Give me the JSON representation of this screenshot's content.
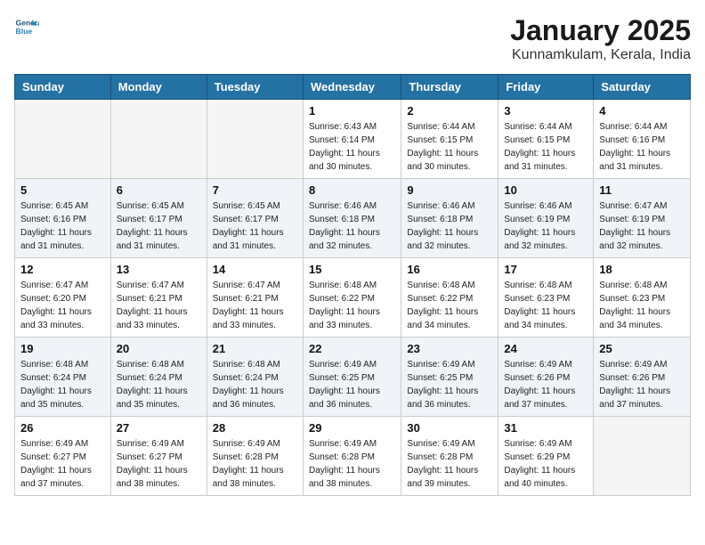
{
  "header": {
    "logo_line1": "General",
    "logo_line2": "Blue",
    "month": "January 2025",
    "location": "Kunnamkulam, Kerala, India"
  },
  "weekdays": [
    "Sunday",
    "Monday",
    "Tuesday",
    "Wednesday",
    "Thursday",
    "Friday",
    "Saturday"
  ],
  "weeks": [
    [
      {
        "day": "",
        "info": ""
      },
      {
        "day": "",
        "info": ""
      },
      {
        "day": "",
        "info": ""
      },
      {
        "day": "1",
        "info": "Sunrise: 6:43 AM\nSunset: 6:14 PM\nDaylight: 11 hours\nand 30 minutes."
      },
      {
        "day": "2",
        "info": "Sunrise: 6:44 AM\nSunset: 6:15 PM\nDaylight: 11 hours\nand 30 minutes."
      },
      {
        "day": "3",
        "info": "Sunrise: 6:44 AM\nSunset: 6:15 PM\nDaylight: 11 hours\nand 31 minutes."
      },
      {
        "day": "4",
        "info": "Sunrise: 6:44 AM\nSunset: 6:16 PM\nDaylight: 11 hours\nand 31 minutes."
      }
    ],
    [
      {
        "day": "5",
        "info": "Sunrise: 6:45 AM\nSunset: 6:16 PM\nDaylight: 11 hours\nand 31 minutes."
      },
      {
        "day": "6",
        "info": "Sunrise: 6:45 AM\nSunset: 6:17 PM\nDaylight: 11 hours\nand 31 minutes."
      },
      {
        "day": "7",
        "info": "Sunrise: 6:45 AM\nSunset: 6:17 PM\nDaylight: 11 hours\nand 31 minutes."
      },
      {
        "day": "8",
        "info": "Sunrise: 6:46 AM\nSunset: 6:18 PM\nDaylight: 11 hours\nand 32 minutes."
      },
      {
        "day": "9",
        "info": "Sunrise: 6:46 AM\nSunset: 6:18 PM\nDaylight: 11 hours\nand 32 minutes."
      },
      {
        "day": "10",
        "info": "Sunrise: 6:46 AM\nSunset: 6:19 PM\nDaylight: 11 hours\nand 32 minutes."
      },
      {
        "day": "11",
        "info": "Sunrise: 6:47 AM\nSunset: 6:19 PM\nDaylight: 11 hours\nand 32 minutes."
      }
    ],
    [
      {
        "day": "12",
        "info": "Sunrise: 6:47 AM\nSunset: 6:20 PM\nDaylight: 11 hours\nand 33 minutes."
      },
      {
        "day": "13",
        "info": "Sunrise: 6:47 AM\nSunset: 6:21 PM\nDaylight: 11 hours\nand 33 minutes."
      },
      {
        "day": "14",
        "info": "Sunrise: 6:47 AM\nSunset: 6:21 PM\nDaylight: 11 hours\nand 33 minutes."
      },
      {
        "day": "15",
        "info": "Sunrise: 6:48 AM\nSunset: 6:22 PM\nDaylight: 11 hours\nand 33 minutes."
      },
      {
        "day": "16",
        "info": "Sunrise: 6:48 AM\nSunset: 6:22 PM\nDaylight: 11 hours\nand 34 minutes."
      },
      {
        "day": "17",
        "info": "Sunrise: 6:48 AM\nSunset: 6:23 PM\nDaylight: 11 hours\nand 34 minutes."
      },
      {
        "day": "18",
        "info": "Sunrise: 6:48 AM\nSunset: 6:23 PM\nDaylight: 11 hours\nand 34 minutes."
      }
    ],
    [
      {
        "day": "19",
        "info": "Sunrise: 6:48 AM\nSunset: 6:24 PM\nDaylight: 11 hours\nand 35 minutes."
      },
      {
        "day": "20",
        "info": "Sunrise: 6:48 AM\nSunset: 6:24 PM\nDaylight: 11 hours\nand 35 minutes."
      },
      {
        "day": "21",
        "info": "Sunrise: 6:48 AM\nSunset: 6:24 PM\nDaylight: 11 hours\nand 36 minutes."
      },
      {
        "day": "22",
        "info": "Sunrise: 6:49 AM\nSunset: 6:25 PM\nDaylight: 11 hours\nand 36 minutes."
      },
      {
        "day": "23",
        "info": "Sunrise: 6:49 AM\nSunset: 6:25 PM\nDaylight: 11 hours\nand 36 minutes."
      },
      {
        "day": "24",
        "info": "Sunrise: 6:49 AM\nSunset: 6:26 PM\nDaylight: 11 hours\nand 37 minutes."
      },
      {
        "day": "25",
        "info": "Sunrise: 6:49 AM\nSunset: 6:26 PM\nDaylight: 11 hours\nand 37 minutes."
      }
    ],
    [
      {
        "day": "26",
        "info": "Sunrise: 6:49 AM\nSunset: 6:27 PM\nDaylight: 11 hours\nand 37 minutes."
      },
      {
        "day": "27",
        "info": "Sunrise: 6:49 AM\nSunset: 6:27 PM\nDaylight: 11 hours\nand 38 minutes."
      },
      {
        "day": "28",
        "info": "Sunrise: 6:49 AM\nSunset: 6:28 PM\nDaylight: 11 hours\nand 38 minutes."
      },
      {
        "day": "29",
        "info": "Sunrise: 6:49 AM\nSunset: 6:28 PM\nDaylight: 11 hours\nand 38 minutes."
      },
      {
        "day": "30",
        "info": "Sunrise: 6:49 AM\nSunset: 6:28 PM\nDaylight: 11 hours\nand 39 minutes."
      },
      {
        "day": "31",
        "info": "Sunrise: 6:49 AM\nSunset: 6:29 PM\nDaylight: 11 hours\nand 40 minutes."
      },
      {
        "day": "",
        "info": ""
      }
    ]
  ]
}
